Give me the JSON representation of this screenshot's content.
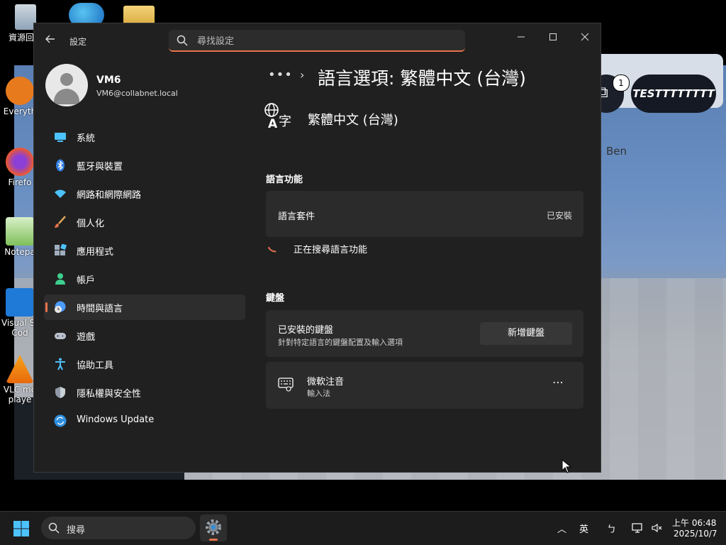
{
  "desktop": {
    "icons": [
      {
        "label": "資源回收",
        "icon": "recycle-bin-icon"
      },
      {
        "label": "Everyth",
        "icon": "everything-search-icon"
      },
      {
        "label": "Firefo",
        "icon": "firefox-icon"
      },
      {
        "label": "Notepa",
        "icon": "notepad-icon"
      },
      {
        "label": "Visual St",
        "label2": "Cod",
        "icon": "vscode-icon"
      },
      {
        "label": "VLC me",
        "label2": "playe",
        "icon": "vlc-icon"
      }
    ],
    "background_app": {
      "badge_count": "1",
      "pill_text": "TESTTTTTTTT",
      "card_text": "Ben"
    }
  },
  "window": {
    "app_title": "設定",
    "search_placeholder": "尋找設定",
    "controls": {
      "minimize": "—",
      "maximize": "☐",
      "close": "✕"
    }
  },
  "profile": {
    "name": "VM6",
    "email": "VM6@collabnet.local"
  },
  "nav": {
    "items": [
      {
        "label": "系統",
        "icon": "monitor-icon"
      },
      {
        "label": "藍牙與裝置",
        "icon": "bluetooth-icon"
      },
      {
        "label": "網路和網際網路",
        "icon": "wifi-icon"
      },
      {
        "label": "個人化",
        "icon": "paintbrush-icon"
      },
      {
        "label": "應用程式",
        "icon": "apps-icon"
      },
      {
        "label": "帳戶",
        "icon": "account-icon"
      },
      {
        "label": "時間與語言",
        "icon": "globe-clock-icon",
        "active": true
      },
      {
        "label": "遊戲",
        "icon": "gamepad-icon"
      },
      {
        "label": "協助工具",
        "icon": "accessibility-icon"
      },
      {
        "label": "隱私權與安全性",
        "icon": "shield-icon"
      },
      {
        "label": "Windows Update",
        "icon": "windows-update-icon"
      }
    ]
  },
  "content": {
    "breadcrumb_more": "•••",
    "breadcrumb_sep": "›",
    "page_title": "語言選項: 繁體中文 (台灣)",
    "language_name": "繁體中文 (台灣)",
    "language_features": {
      "heading": "語言功能",
      "pack_label": "語言套件",
      "pack_status": "已安裝",
      "loading_text": "正在搜尋語言功能"
    },
    "keyboards": {
      "heading": "鍵盤",
      "installed_title": "已安裝的鍵盤",
      "installed_sub": "針對特定語言的鍵盤配置及輸入選項",
      "add_button": "新增鍵盤",
      "ime_name": "微軟注音",
      "ime_type": "輸入法",
      "more": "⋯"
    }
  },
  "taskbar": {
    "search_text": "搜尋",
    "tray": {
      "chevron": "︿",
      "ime_mode": "英",
      "ime_symbol": "ㄅ"
    },
    "clock": {
      "time": "上午 06:48",
      "date": "2025/10/7"
    }
  },
  "colors": {
    "accent": "#e8734a",
    "window_bg": "#202020",
    "card_bg": "#2b2b2b",
    "taskbar_bg": "#1c1c1c"
  }
}
